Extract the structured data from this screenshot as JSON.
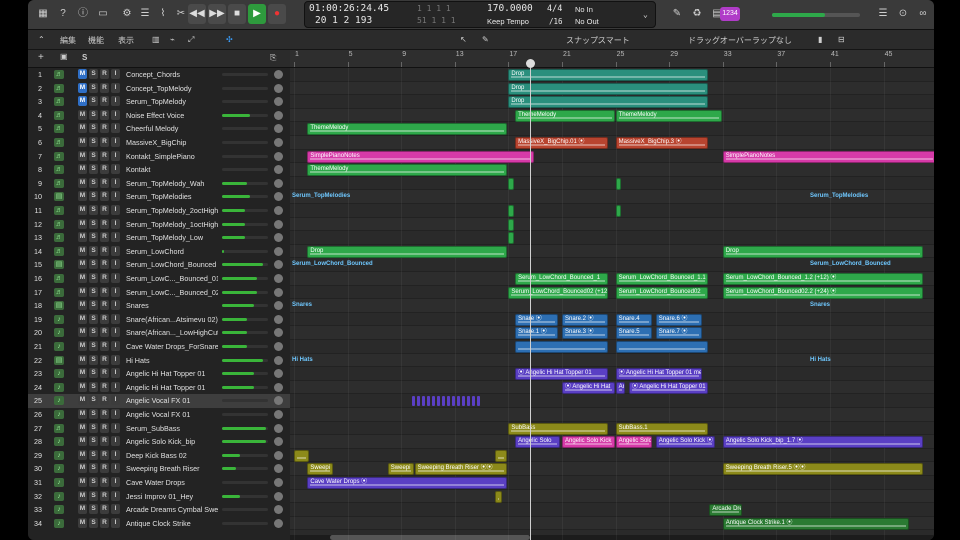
{
  "toolbar": {
    "icons": [
      "library-icon",
      "help-icon",
      "info-icon",
      "toolbar-icon",
      "mixer-icon",
      "smart-controls-icon",
      "editors-icon",
      "scissors-icon"
    ],
    "transport": [
      "◀◀",
      "▶▶",
      "■",
      "▶",
      "●"
    ],
    "right_icons": [
      "notes-icon",
      "apple-loops-icon",
      "browser-icon"
    ],
    "badge": "1234"
  },
  "lcd": {
    "time": "01:00:26:24.45",
    "bars": "20  1  2  193",
    "extra1": "1  1  1  1",
    "extra2": "51  1  1  1",
    "extra3": "1  1  1  1",
    "extra4": "1  1  1  1",
    "tempo": "170.0000",
    "tempo_mode": "Keep Tempo",
    "sig_top": "4/4",
    "sig_bottom": "/16",
    "midi_in": "No In",
    "midi_out": "No Out"
  },
  "secondbar": {
    "menu1": "編集",
    "menu2": "機能",
    "menu3": "表示",
    "snap_label": "スナップ:",
    "snap_value": "スマート",
    "drag_label": "ドラッグ:",
    "drag_value": "オーバーラップなし"
  },
  "ruler": {
    "bars": [
      "1",
      "5",
      "9",
      "13",
      "17",
      "21",
      "25",
      "29",
      "33",
      "37",
      "41",
      "45",
      "49"
    ]
  },
  "tracks": [
    {
      "n": "1",
      "name": "Concept_Chords",
      "m": true,
      "icon": "♬",
      "vol": 0
    },
    {
      "n": "2",
      "name": "Concept_TopMelody",
      "m": true,
      "icon": "♬",
      "vol": 0
    },
    {
      "n": "3",
      "name": "Serum_TopMelody",
      "m": true,
      "icon": "♬",
      "vol": 0
    },
    {
      "n": "4",
      "name": "Noise Effect Voice",
      "m": false,
      "icon": "♬",
      "vol": 60
    },
    {
      "n": "5",
      "name": "Cheerful Melody",
      "m": false,
      "icon": "♬",
      "vol": 0
    },
    {
      "n": "6",
      "name": "MassiveX_BigChip",
      "m": false,
      "icon": "♬",
      "vol": 0
    },
    {
      "n": "7",
      "name": "Kontakt_SimplePiano",
      "m": false,
      "icon": "♬",
      "vol": 0
    },
    {
      "n": "8",
      "name": "Kontakt",
      "m": false,
      "icon": "♬",
      "vol": 0
    },
    {
      "n": "9",
      "name": "Serum_TopMelody_Wah",
      "m": false,
      "icon": "♬",
      "vol": 55
    },
    {
      "n": "10",
      "name": "Serum_TopMelodies",
      "m": false,
      "icon": "▤",
      "vol": 60
    },
    {
      "n": "11",
      "name": "Serum_TopMelody_2octHigh",
      "m": false,
      "icon": "♬",
      "vol": 50
    },
    {
      "n": "12",
      "name": "Serum_TopMelody_1octHigh",
      "m": false,
      "icon": "♬",
      "vol": 50
    },
    {
      "n": "13",
      "name": "Serum_TopMelody_Low",
      "m": false,
      "icon": "♬",
      "vol": 50
    },
    {
      "n": "14",
      "name": "Serum_LowChord",
      "m": false,
      "icon": "♬",
      "vol": 5
    },
    {
      "n": "15",
      "name": "Serum_LowChord_Bounced",
      "m": false,
      "icon": "▤",
      "vol": 90
    },
    {
      "n": "16",
      "name": "Serum_LowC..._Bounced_01",
      "m": false,
      "icon": "♬",
      "vol": 75
    },
    {
      "n": "17",
      "name": "Serum_LowC..._Bounced_02",
      "m": false,
      "icon": "♬",
      "vol": 75
    },
    {
      "n": "18",
      "name": "Snares",
      "m": false,
      "icon": "▤",
      "vol": 70
    },
    {
      "n": "19",
      "name": "Snare(African...Atsimevu 02)",
      "m": false,
      "icon": "♪",
      "vol": 55
    },
    {
      "n": "20",
      "name": "Snare(African..._LowHighCut",
      "m": false,
      "icon": "♪",
      "vol": 55
    },
    {
      "n": "21",
      "name": "Cave Water Drops_ForSnare",
      "m": false,
      "icon": "♪",
      "vol": 55
    },
    {
      "n": "22",
      "name": "Hi Hats",
      "m": false,
      "icon": "▤",
      "vol": 90
    },
    {
      "n": "23",
      "name": "Angelic Hi Hat Topper 01",
      "m": false,
      "icon": "♪",
      "vol": 70
    },
    {
      "n": "24",
      "name": "Angelic Hi Hat Topper 01",
      "m": false,
      "icon": "♪",
      "vol": 70
    },
    {
      "n": "25",
      "name": "Angelic Vocal FX 01",
      "m": false,
      "icon": "♪",
      "vol": 0,
      "sel": true
    },
    {
      "n": "26",
      "name": "Angelic Vocal FX 01",
      "m": false,
      "icon": "♪",
      "vol": 0
    },
    {
      "n": "27",
      "name": "Serum_SubBass",
      "m": false,
      "icon": "♬",
      "vol": 95
    },
    {
      "n": "28",
      "name": "Angelic Solo Kick_bip",
      "m": false,
      "icon": "♪",
      "vol": 95
    },
    {
      "n": "29",
      "name": "Deep Kick Bass 02",
      "m": false,
      "icon": "♪",
      "vol": 40
    },
    {
      "n": "30",
      "name": "Sweeping Breath Riser",
      "m": false,
      "icon": "♪",
      "vol": 30
    },
    {
      "n": "31",
      "name": "Cave Water Drops",
      "m": false,
      "icon": "♪",
      "vol": 0
    },
    {
      "n": "32",
      "name": "Jessi Improv 01_Hey",
      "m": false,
      "icon": "♪",
      "vol": 40
    },
    {
      "n": "33",
      "name": "Arcade Dreams Cymbal Swell",
      "m": false,
      "icon": "♪",
      "vol": 0
    },
    {
      "n": "34",
      "name": "Antique Clock Strike",
      "m": false,
      "icon": "♪",
      "vol": 0
    }
  ],
  "folders": [
    {
      "row": 9,
      "left": "Serum_TopMelodies",
      "right": "Serum_TopMelodies"
    },
    {
      "row": 14,
      "left": "Serum_LowChord_Bounced",
      "right": "Serum_LowChord_Bounced"
    },
    {
      "row": 17,
      "left": "Snares",
      "right": "Snares"
    },
    {
      "row": 21,
      "left": "Hi Hats",
      "right": "Hi Hats"
    }
  ],
  "colors": {
    "green": "#2ea84a",
    "red": "#b8442f",
    "pink": "#d63aa8",
    "teal": "#2a8f7d",
    "blue": "#2d6fb3",
    "violet": "#5a3fc4",
    "olive": "#8c8a1a",
    "darkgreen": "#2a7a32",
    "folder_text": "#6fc8ff"
  },
  "regions": [
    {
      "row": 0,
      "bar": 17,
      "len": 15,
      "label": "Drop",
      "c": "teal"
    },
    {
      "row": 1,
      "bar": 17,
      "len": 15,
      "label": "Drop",
      "c": "teal"
    },
    {
      "row": 2,
      "bar": 17,
      "len": 15,
      "label": "Drop",
      "c": "teal"
    },
    {
      "row": 3,
      "bar": 17.5,
      "len": 7.5,
      "label": "ThemeMelody",
      "c": "green"
    },
    {
      "row": 3,
      "bar": 25,
      "len": 8,
      "label": "ThemeMelody",
      "c": "green"
    },
    {
      "row": 4,
      "bar": 2,
      "len": 15,
      "label": "ThemeMelody",
      "c": "green"
    },
    {
      "row": 5,
      "bar": 17.5,
      "len": 7,
      "label": "MassiveX_BigChip.01 ⦿",
      "c": "red"
    },
    {
      "row": 5,
      "bar": 25,
      "len": 7,
      "label": "MassiveX_BigChip.3 ⦿",
      "c": "red"
    },
    {
      "row": 6,
      "bar": 2,
      "len": 17,
      "label": "SimplePianoNotes",
      "c": "pink"
    },
    {
      "row": 6,
      "bar": 33,
      "len": 16,
      "label": "SimplePianoNotes",
      "c": "pink"
    },
    {
      "row": 7,
      "bar": 2,
      "len": 15,
      "label": "ThemeMelody",
      "c": "green"
    },
    {
      "row": 8,
      "bar": 17,
      "len": 0.5,
      "label": "",
      "c": "green"
    },
    {
      "row": 8,
      "bar": 25,
      "len": 0.5,
      "label": "",
      "c": "green"
    },
    {
      "row": 10,
      "bar": 17,
      "len": 0.5,
      "label": "",
      "c": "green"
    },
    {
      "row": 10,
      "bar": 25,
      "len": 0.5,
      "label": "",
      "c": "green"
    },
    {
      "row": 11,
      "bar": 17,
      "len": 0.5,
      "label": "",
      "c": "green"
    },
    {
      "row": 12,
      "bar": 17,
      "len": 0.5,
      "label": "",
      "c": "green"
    },
    {
      "row": 13,
      "bar": 2,
      "len": 15,
      "label": "Drop",
      "c": "green"
    },
    {
      "row": 13,
      "bar": 33,
      "len": 15,
      "label": "Drop",
      "c": "green"
    },
    {
      "row": 15,
      "bar": 17.5,
      "len": 7,
      "label": "Serum_LowChord_Bounced_1",
      "c": "green"
    },
    {
      "row": 15,
      "bar": 25,
      "len": 7,
      "label": "Serum_LowChord_Bounced_1.1",
      "c": "green"
    },
    {
      "row": 15,
      "bar": 33,
      "len": 15,
      "label": "Serum_LowChord_Bounced_1.2 (+12) ⦿",
      "c": "green"
    },
    {
      "row": 16,
      "bar": 17,
      "len": 7.5,
      "label": "Serum_LowChord_Bounced02 (+12",
      "c": "green"
    },
    {
      "row": 16,
      "bar": 25,
      "len": 7,
      "label": "Serum_LowChord_Bounced02",
      "c": "green"
    },
    {
      "row": 16,
      "bar": 33,
      "len": 15,
      "label": "Serum_LowChord_Bounced02.2 (+24) ⦿",
      "c": "green"
    },
    {
      "row": 18,
      "bar": 17.5,
      "len": 3.3,
      "label": "Snare ⦿",
      "c": "blue"
    },
    {
      "row": 18,
      "bar": 21,
      "len": 3.5,
      "label": "Snare.2 ⦿",
      "c": "blue"
    },
    {
      "row": 18,
      "bar": 25,
      "len": 2.8,
      "label": "Snare.4",
      "c": "blue"
    },
    {
      "row": 18,
      "bar": 28,
      "len": 3.5,
      "label": "Snare.6 ⦿",
      "c": "blue"
    },
    {
      "row": 19,
      "bar": 17.5,
      "len": 3.3,
      "label": "Snare.1 ⦿",
      "c": "blue"
    },
    {
      "row": 19,
      "bar": 21,
      "len": 3.5,
      "label": "Snare.3 ⦿",
      "c": "blue"
    },
    {
      "row": 19,
      "bar": 25,
      "len": 2.8,
      "label": "Snare.5",
      "c": "blue"
    },
    {
      "row": 19,
      "bar": 28,
      "len": 3.5,
      "label": "Snare.7 ⦿",
      "c": "blue"
    },
    {
      "row": 20,
      "bar": 17.5,
      "len": 7,
      "label": "",
      "c": "blue"
    },
    {
      "row": 20,
      "bar": 25,
      "len": 7,
      "label": "",
      "c": "blue"
    },
    {
      "row": 22,
      "bar": 17.5,
      "len": 7,
      "label": "⦿ Angelic Hi Hat Topper 01",
      "c": "violet"
    },
    {
      "row": 22,
      "bar": 25,
      "len": 6.5,
      "label": "⦿ Angelic Hi Hat Topper 01 merg",
      "c": "violet"
    },
    {
      "row": 23,
      "bar": 21,
      "len": 4,
      "label": "⦿ Angelic Hi Hat",
      "c": "violet"
    },
    {
      "row": 23,
      "bar": 25,
      "len": 0.8,
      "label": "An",
      "c": "violet"
    },
    {
      "row": 23,
      "bar": 26,
      "len": 6,
      "label": "⦿ Angelic Hi Hat Topper 01",
      "c": "violet"
    },
    {
      "row": 26,
      "bar": 17,
      "len": 7.5,
      "label": "SubBass",
      "c": "olive"
    },
    {
      "row": 26,
      "bar": 25,
      "len": 7,
      "label": "SubBass.1",
      "c": "olive"
    },
    {
      "row": 27,
      "bar": 17.5,
      "len": 3.4,
      "label": "Angelic Solo",
      "c": "violet"
    },
    {
      "row": 27,
      "bar": 21,
      "len": 4,
      "label": "Angelic Solo Kick",
      "c": "pink"
    },
    {
      "row": 27,
      "bar": 25,
      "len": 2.8,
      "label": "Angelic Solo",
      "c": "pink"
    },
    {
      "row": 27,
      "bar": 28,
      "len": 4.5,
      "label": "Angelic Solo Kick ⦿",
      "c": "violet"
    },
    {
      "row": 27,
      "bar": 33,
      "len": 15,
      "label": "Angelic Solo Kick_bip_1.7 ⦿",
      "c": "violet"
    },
    {
      "row": 28,
      "bar": 1,
      "len": 1.2,
      "label": "",
      "c": "olive"
    },
    {
      "row": 28,
      "bar": 16,
      "len": 1,
      "label": "",
      "c": "olive"
    },
    {
      "row": 29,
      "bar": 2,
      "len": 2,
      "label": "Sweepi",
      "c": "olive"
    },
    {
      "row": 29,
      "bar": 8,
      "len": 2,
      "label": "Sweepi",
      "c": "olive"
    },
    {
      "row": 29,
      "bar": 10,
      "len": 7,
      "label": "Sweeping Breath Riser ⦿⦿",
      "c": "olive"
    },
    {
      "row": 29,
      "bar": 33,
      "len": 15,
      "label": "Sweeping Breath Riser.5 ⦿⦿",
      "c": "olive"
    },
    {
      "row": 30,
      "bar": 2,
      "len": 15,
      "label": "Cave Water Drops ⦿",
      "c": "violet"
    },
    {
      "row": 31,
      "bar": 16,
      "len": 0.6,
      "label": "",
      "c": "olive"
    },
    {
      "row": 32,
      "bar": 32,
      "len": 2.5,
      "label": "Arcade Drea",
      "c": "darkgreen"
    },
    {
      "row": 33,
      "bar": 33,
      "len": 14,
      "label": "Antique Clock Strike.1 ⦿",
      "c": "darkgreen"
    }
  ]
}
